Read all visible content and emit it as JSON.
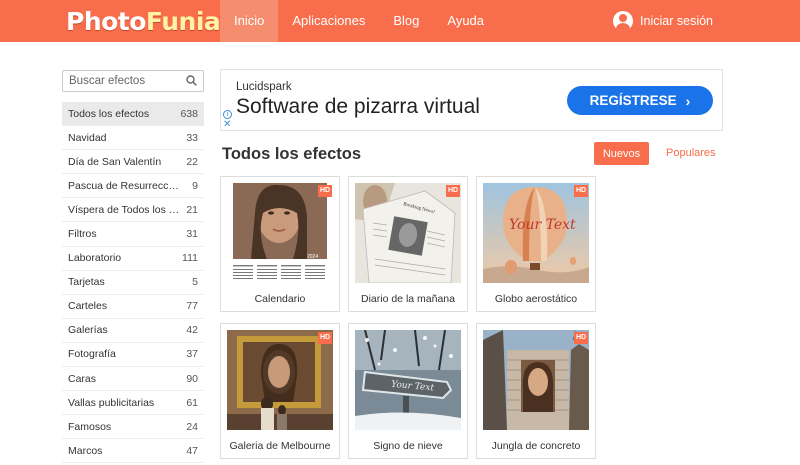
{
  "header": {
    "logo_part1": "Photo",
    "logo_part2": "Funia",
    "nav": [
      {
        "label": "Inicio"
      },
      {
        "label": "Aplicaciones"
      },
      {
        "label": "Blog"
      },
      {
        "label": "Ayuda"
      }
    ],
    "login_label": "Iniciar sesión"
  },
  "sidebar": {
    "search_placeholder": "Buscar efectos",
    "categories": [
      {
        "name": "Todos los efectos",
        "count": "638"
      },
      {
        "name": "Navidad",
        "count": "33"
      },
      {
        "name": "Día de San Valentín",
        "count": "22"
      },
      {
        "name": "Pascua de Resurrección",
        "count": "9"
      },
      {
        "name": "Víspera de Todos los S...",
        "count": "21"
      },
      {
        "name": "Filtros",
        "count": "31"
      },
      {
        "name": "Laboratorio",
        "count": "111"
      },
      {
        "name": "Tarjetas",
        "count": "5"
      },
      {
        "name": "Carteles",
        "count": "77"
      },
      {
        "name": "Galerías",
        "count": "42"
      },
      {
        "name": "Fotografía",
        "count": "37"
      },
      {
        "name": "Caras",
        "count": "90"
      },
      {
        "name": "Vallas publicitarias",
        "count": "61"
      },
      {
        "name": "Famosos",
        "count": "24"
      },
      {
        "name": "Marcos",
        "count": "47"
      }
    ]
  },
  "ad": {
    "brand": "Lucidspark",
    "title": "Software de pizarra virtual",
    "cta": "REGÍSTRESE",
    "cta_chevron": "›",
    "info": "i",
    "close": "✕"
  },
  "main": {
    "title": "Todos los efectos",
    "tab_new": "Nuevos",
    "tab_popular": "Populares",
    "effects": [
      {
        "label": "Calendario",
        "badge": "HD",
        "calendar_year": "2024"
      },
      {
        "label": "Diario de la mañana",
        "badge": "HD",
        "newspaper_title": "Breaking News!"
      },
      {
        "label": "Globo aerostático",
        "badge": "HD",
        "balloon_text": "Your Text"
      },
      {
        "label": "Galeria de Melbourne",
        "badge": "HD"
      },
      {
        "label": "Signo de nieve",
        "badge": "",
        "sign_text": "Your Text"
      },
      {
        "label": "Jungla de concreto",
        "badge": "HD"
      }
    ]
  },
  "colors": {
    "brand": "#f86d4b",
    "ad_button": "#1a73e8"
  }
}
